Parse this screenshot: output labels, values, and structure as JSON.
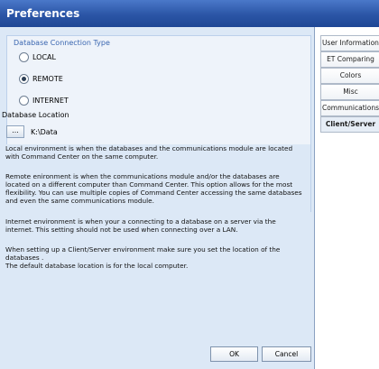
{
  "window": {
    "title": "Preferences"
  },
  "connection": {
    "section_label": "Database Connection Type",
    "options": [
      {
        "label": "LOCAL",
        "selected": false
      },
      {
        "label": "REMOTE",
        "selected": true
      },
      {
        "label": "INTERNET",
        "selected": false
      }
    ]
  },
  "database": {
    "label": "Database Location",
    "browse_label": "...",
    "path": "K:\\Data"
  },
  "description": [
    "Local environment is when the databases and the communications module are located with Command Center on the same computer.",
    "Remote enironment is when the communications module and/or the databases are located on a different computer than Command Center.  This option allows for the most flexibility.  You can use multiple copies of Command Center accessing the same databases and even the same communications module.",
    "Internet environment is when your a connecting to a database on a server via the internet.  This setting should not be used when connecting over a LAN.",
    "When setting up a Client/Server environment make sure you set the location of the databases .\nThe default database location is for the local computer."
  ],
  "buttons": {
    "ok": "OK",
    "cancel": "Cancel"
  },
  "tabs": [
    {
      "label": "User Information",
      "selected": false
    },
    {
      "label": "ET Comparing",
      "selected": false
    },
    {
      "label": "Colors",
      "selected": false
    },
    {
      "label": "Misc",
      "selected": false
    },
    {
      "label": "Communications",
      "selected": false
    },
    {
      "label": "Client/Server",
      "selected": true
    }
  ]
}
